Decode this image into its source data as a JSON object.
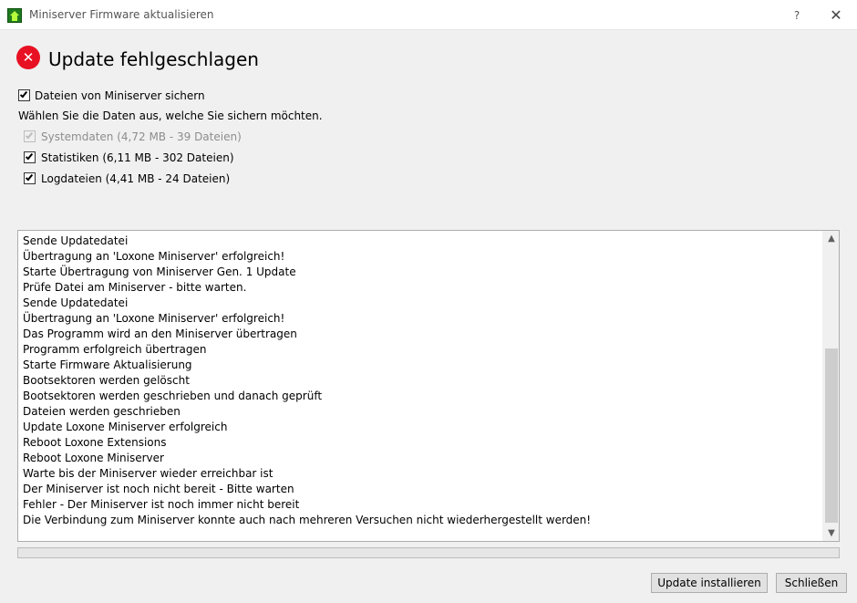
{
  "window": {
    "title": "Miniserver Firmware aktualisieren",
    "help_label": "?",
    "close_label": "✕"
  },
  "header": {
    "status_icon": "error-icon",
    "title": "Update fehlgeschlagen",
    "accent_color": "#e81123"
  },
  "backup": {
    "main_checkbox": {
      "label": "Dateien von Miniserver sichern",
      "checked": true
    },
    "instruction": "Wählen Sie die Daten aus, welche Sie sichern möchten.",
    "items": [
      {
        "label": "Systemdaten (4,72 MB - 39 Dateien)",
        "checked": true,
        "disabled": true
      },
      {
        "label": "Statistiken (6,11 MB - 302 Dateien)",
        "checked": true,
        "disabled": false
      },
      {
        "label": "Logdateien (4,41 MB - 24 Dateien)",
        "checked": true,
        "disabled": false
      }
    ]
  },
  "log": {
    "lines": [
      "Sende Updatedatei",
      "Übertragung an 'Loxone Miniserver' erfolgreich!",
      "Starte Übertragung von Miniserver Gen. 1 Update",
      "Prüfe Datei am Miniserver - bitte warten.",
      "Sende Updatedatei",
      "Übertragung an 'Loxone Miniserver' erfolgreich!",
      "Das Programm wird an den Miniserver übertragen",
      "Programm erfolgreich übertragen",
      "Starte Firmware Aktualisierung",
      "Bootsektoren werden gelöscht",
      "Bootsektoren werden geschrieben und danach geprüft",
      "Dateien werden geschrieben",
      "Update Loxone Miniserver erfolgreich",
      "Reboot Loxone Extensions",
      "Reboot Loxone Miniserver",
      "Warte bis der Miniserver wieder erreichbar ist",
      "Der Miniserver ist noch nicht bereit - Bitte warten",
      "Fehler - Der Miniserver ist noch immer nicht bereit",
      "Die Verbindung zum Miniserver konnte auch nach mehreren Versuchen nicht wiederhergestellt werden!"
    ]
  },
  "progress": {
    "value": 0
  },
  "buttons": {
    "install": "Update installieren",
    "close": "Schließen"
  }
}
